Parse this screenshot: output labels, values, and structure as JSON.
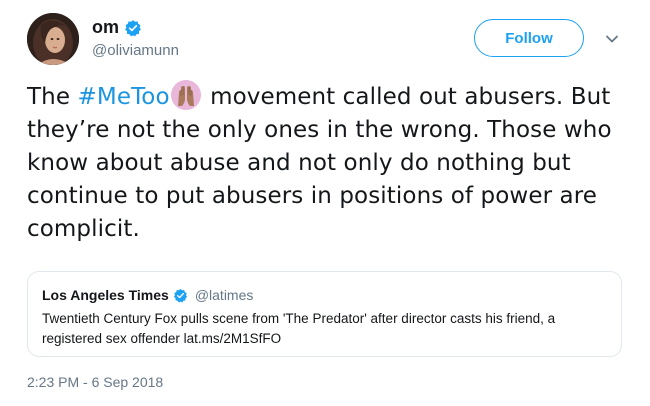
{
  "author": {
    "display_name": "om",
    "handle": "@oliviamunn",
    "verified": true,
    "avatar_icon": "avatar-photo"
  },
  "actions": {
    "follow_label": "Follow",
    "more_icon": "chevron-down-icon"
  },
  "tweet": {
    "text_before": "The ",
    "hashtag": "#MeToo",
    "emoji_icon": "raised-hands-emoji",
    "text_after": " movement called out abusers. But they’re not the only ones in the wrong. Those who know about abuse and not only do nothing but continue to put abusers in positions of power are complicit.",
    "timestamp": "2:23 PM - 6 Sep 2018"
  },
  "quoted_tweet": {
    "display_name": "Los Angeles Times",
    "verified": true,
    "handle": "@latimes",
    "text": "Twentieth Century Fox pulls scene from 'The Predator' after director casts his friend, a registered sex offender lat.ms/2M1SfFO"
  },
  "colors": {
    "link_blue": "#1b95e0",
    "twitter_blue": "#1da1f2",
    "secondary_text": "#657786",
    "border": "#e1e8ed",
    "emoji_bg": "#e8b7d9"
  }
}
